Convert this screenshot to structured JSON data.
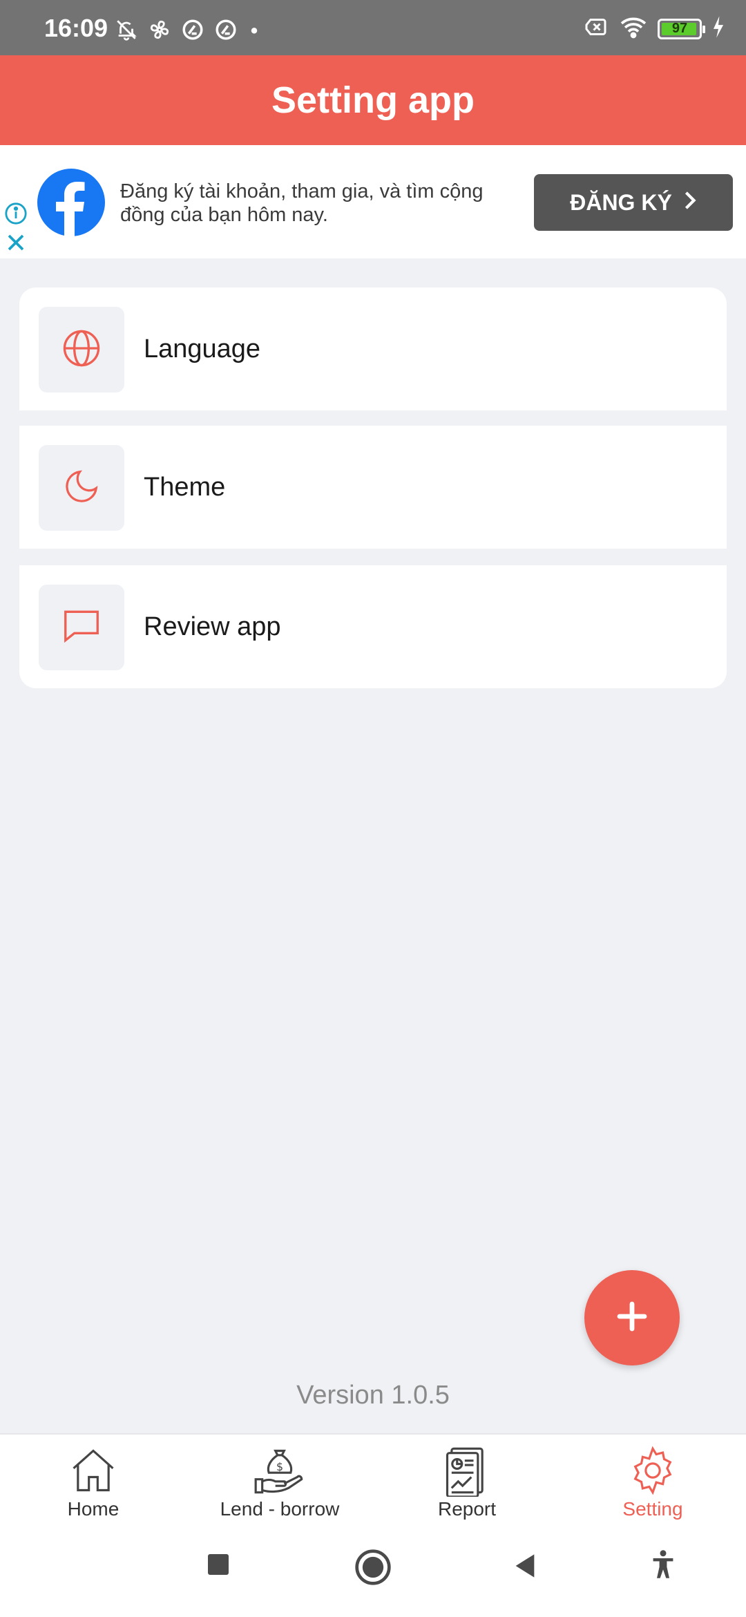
{
  "status_bar": {
    "time": "16:09",
    "battery": "97",
    "battery_fraction": 0.97
  },
  "header": {
    "title": "Setting app"
  },
  "ad": {
    "text": "Đăng ký tài khoản, tham gia, và tìm cộng đồng của bạn hôm nay.",
    "cta_label": "ĐĂNG KÝ"
  },
  "settings": {
    "items": [
      {
        "label": "Language",
        "icon": "globe-icon"
      },
      {
        "label": "Theme",
        "icon": "moon-icon"
      },
      {
        "label": "Review app",
        "icon": "chat-bubble-icon"
      }
    ]
  },
  "footer": {
    "version": "Version  1.0.5"
  },
  "nav": {
    "items": [
      {
        "label": "Home",
        "icon": "home-icon"
      },
      {
        "label": "Lend - borrow",
        "icon": "money-bag-hand-icon"
      },
      {
        "label": "Report",
        "icon": "report-icon"
      },
      {
        "label": "Setting",
        "icon": "gear-icon",
        "active": true
      }
    ]
  },
  "colors": {
    "accent": "#ee5f54",
    "status_bar": "#737373",
    "background": "#f0f1f5",
    "ad_button": "#555555",
    "facebook_blue": "#1877f2"
  }
}
